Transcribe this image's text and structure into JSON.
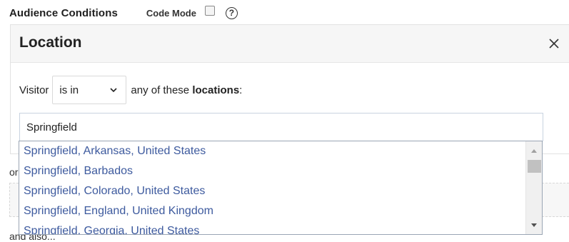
{
  "header": {
    "title": "Audience Conditions",
    "code_mode_label": "Code Mode",
    "code_mode_checked": false,
    "help_glyph": "?"
  },
  "location_card": {
    "title": "Location",
    "close_icon": "close-icon",
    "visitor_label": "Visitor",
    "operator_selected": "is in",
    "after_text_prefix": "any of these ",
    "after_text_bold": "locations",
    "after_text_suffix": ":",
    "search_value": "Springfield"
  },
  "suggestions": [
    "Springfield, Arkansas, United States",
    "Springfield, Barbados",
    "Springfield, Colorado, United States",
    "Springfield, England, United Kingdom",
    "Springfield, Georgia, United States"
  ],
  "below": {
    "or_text": "or",
    "and_also_text": "and also..."
  },
  "colors": {
    "link_blue": "#3d5a9e",
    "header_bg": "#f6f6f6"
  }
}
